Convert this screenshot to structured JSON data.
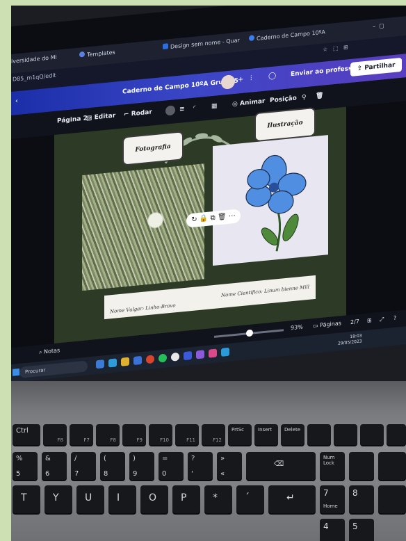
{
  "browser": {
    "tabs": [
      {
        "label": "iversidade do Mi"
      },
      {
        "label": "Templates"
      },
      {
        "label": "Design sem nome - Quar"
      },
      {
        "label": "Caderno de Campo 10ºA"
      }
    ],
    "url": "D85_m1qQ/edit"
  },
  "canva": {
    "document_title": "Caderno de Campo 10ºA Grupo 5",
    "send_label": "Enviar ao professor",
    "share_label": "Partilhar"
  },
  "toolbar": {
    "page_label": "Página 2 ·",
    "edit_label": "Editar",
    "rotate_label": "Rodar",
    "animate_label": "Animar",
    "position_label": "Posição"
  },
  "design": {
    "label_photo": "Fotografia",
    "label_illustration": "Ilustração",
    "common_name": "Nome Vulgar: Linho-Bravo",
    "scientific_name": "Nome Científico: Linum bienne Mill"
  },
  "status": {
    "notes_label": "Notas",
    "zoom": "93%",
    "pages_label": "Páginas",
    "page_count": "2/7",
    "time": "18:03",
    "date": "29/05/2023"
  },
  "taskbar": {
    "search_label": "Procurar"
  },
  "keyboard": {
    "row1": [
      "Ctrl",
      "F8",
      "F7",
      "F8",
      "F9",
      "F10",
      "F11",
      "F12",
      "PrtSc",
      "Insert",
      "Delete"
    ],
    "row2": [
      "%",
      "&",
      "/",
      "(",
      ")",
      "=",
      "?",
      "»"
    ],
    "row2_lower": [
      "5",
      "6",
      "7",
      "8",
      "9",
      "0",
      "'",
      "«"
    ],
    "row3": [
      "T",
      "Y",
      "U",
      "I",
      "O",
      "P",
      "*",
      "´"
    ],
    "right_keys": [
      "Num Lock",
      "Home",
      "7",
      "8",
      "4",
      "5"
    ]
  }
}
